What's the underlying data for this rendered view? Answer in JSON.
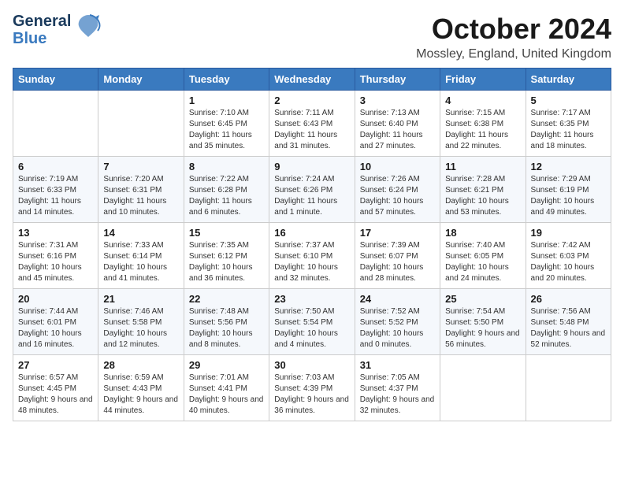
{
  "header": {
    "logo_line1": "General",
    "logo_line2": "Blue",
    "month_title": "October 2024",
    "location": "Mossley, England, United Kingdom"
  },
  "days_of_week": [
    "Sunday",
    "Monday",
    "Tuesday",
    "Wednesday",
    "Thursday",
    "Friday",
    "Saturday"
  ],
  "weeks": [
    [
      {
        "day": "",
        "info": ""
      },
      {
        "day": "",
        "info": ""
      },
      {
        "day": "1",
        "info": "Sunrise: 7:10 AM\nSunset: 6:45 PM\nDaylight: 11 hours and 35 minutes."
      },
      {
        "day": "2",
        "info": "Sunrise: 7:11 AM\nSunset: 6:43 PM\nDaylight: 11 hours and 31 minutes."
      },
      {
        "day": "3",
        "info": "Sunrise: 7:13 AM\nSunset: 6:40 PM\nDaylight: 11 hours and 27 minutes."
      },
      {
        "day": "4",
        "info": "Sunrise: 7:15 AM\nSunset: 6:38 PM\nDaylight: 11 hours and 22 minutes."
      },
      {
        "day": "5",
        "info": "Sunrise: 7:17 AM\nSunset: 6:35 PM\nDaylight: 11 hours and 18 minutes."
      }
    ],
    [
      {
        "day": "6",
        "info": "Sunrise: 7:19 AM\nSunset: 6:33 PM\nDaylight: 11 hours and 14 minutes."
      },
      {
        "day": "7",
        "info": "Sunrise: 7:20 AM\nSunset: 6:31 PM\nDaylight: 11 hours and 10 minutes."
      },
      {
        "day": "8",
        "info": "Sunrise: 7:22 AM\nSunset: 6:28 PM\nDaylight: 11 hours and 6 minutes."
      },
      {
        "day": "9",
        "info": "Sunrise: 7:24 AM\nSunset: 6:26 PM\nDaylight: 11 hours and 1 minute."
      },
      {
        "day": "10",
        "info": "Sunrise: 7:26 AM\nSunset: 6:24 PM\nDaylight: 10 hours and 57 minutes."
      },
      {
        "day": "11",
        "info": "Sunrise: 7:28 AM\nSunset: 6:21 PM\nDaylight: 10 hours and 53 minutes."
      },
      {
        "day": "12",
        "info": "Sunrise: 7:29 AM\nSunset: 6:19 PM\nDaylight: 10 hours and 49 minutes."
      }
    ],
    [
      {
        "day": "13",
        "info": "Sunrise: 7:31 AM\nSunset: 6:16 PM\nDaylight: 10 hours and 45 minutes."
      },
      {
        "day": "14",
        "info": "Sunrise: 7:33 AM\nSunset: 6:14 PM\nDaylight: 10 hours and 41 minutes."
      },
      {
        "day": "15",
        "info": "Sunrise: 7:35 AM\nSunset: 6:12 PM\nDaylight: 10 hours and 36 minutes."
      },
      {
        "day": "16",
        "info": "Sunrise: 7:37 AM\nSunset: 6:10 PM\nDaylight: 10 hours and 32 minutes."
      },
      {
        "day": "17",
        "info": "Sunrise: 7:39 AM\nSunset: 6:07 PM\nDaylight: 10 hours and 28 minutes."
      },
      {
        "day": "18",
        "info": "Sunrise: 7:40 AM\nSunset: 6:05 PM\nDaylight: 10 hours and 24 minutes."
      },
      {
        "day": "19",
        "info": "Sunrise: 7:42 AM\nSunset: 6:03 PM\nDaylight: 10 hours and 20 minutes."
      }
    ],
    [
      {
        "day": "20",
        "info": "Sunrise: 7:44 AM\nSunset: 6:01 PM\nDaylight: 10 hours and 16 minutes."
      },
      {
        "day": "21",
        "info": "Sunrise: 7:46 AM\nSunset: 5:58 PM\nDaylight: 10 hours and 12 minutes."
      },
      {
        "day": "22",
        "info": "Sunrise: 7:48 AM\nSunset: 5:56 PM\nDaylight: 10 hours and 8 minutes."
      },
      {
        "day": "23",
        "info": "Sunrise: 7:50 AM\nSunset: 5:54 PM\nDaylight: 10 hours and 4 minutes."
      },
      {
        "day": "24",
        "info": "Sunrise: 7:52 AM\nSunset: 5:52 PM\nDaylight: 10 hours and 0 minutes."
      },
      {
        "day": "25",
        "info": "Sunrise: 7:54 AM\nSunset: 5:50 PM\nDaylight: 9 hours and 56 minutes."
      },
      {
        "day": "26",
        "info": "Sunrise: 7:56 AM\nSunset: 5:48 PM\nDaylight: 9 hours and 52 minutes."
      }
    ],
    [
      {
        "day": "27",
        "info": "Sunrise: 6:57 AM\nSunset: 4:45 PM\nDaylight: 9 hours and 48 minutes."
      },
      {
        "day": "28",
        "info": "Sunrise: 6:59 AM\nSunset: 4:43 PM\nDaylight: 9 hours and 44 minutes."
      },
      {
        "day": "29",
        "info": "Sunrise: 7:01 AM\nSunset: 4:41 PM\nDaylight: 9 hours and 40 minutes."
      },
      {
        "day": "30",
        "info": "Sunrise: 7:03 AM\nSunset: 4:39 PM\nDaylight: 9 hours and 36 minutes."
      },
      {
        "day": "31",
        "info": "Sunrise: 7:05 AM\nSunset: 4:37 PM\nDaylight: 9 hours and 32 minutes."
      },
      {
        "day": "",
        "info": ""
      },
      {
        "day": "",
        "info": ""
      }
    ]
  ]
}
